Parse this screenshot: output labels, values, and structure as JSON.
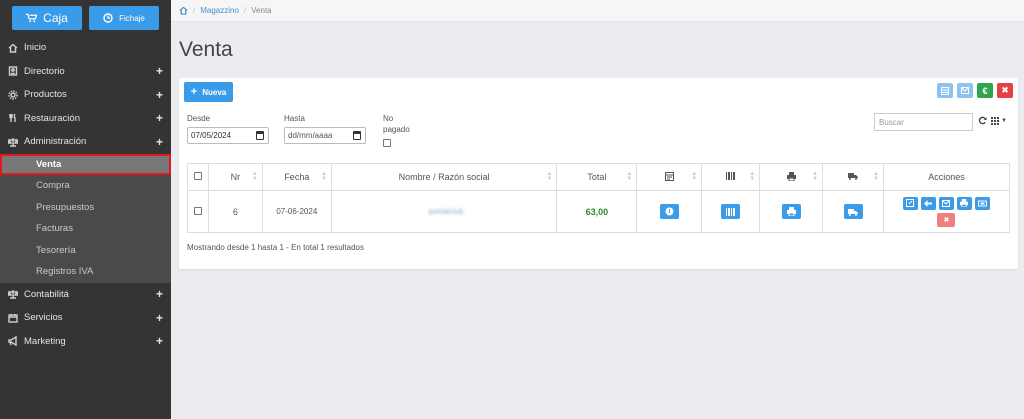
{
  "top_buttons": {
    "caja": "Caja",
    "fichaje": "Fichaje"
  },
  "sidebar": {
    "items": [
      {
        "label": "Inicio",
        "icon": "home-icon"
      },
      {
        "label": "Directorio",
        "icon": "contact-card-icon"
      },
      {
        "label": "Productos",
        "icon": "gear-icon"
      },
      {
        "label": "Restauración",
        "icon": "fork-knife-icon"
      },
      {
        "label": "Administración",
        "icon": "balance-scale-icon"
      }
    ],
    "sub_items": [
      "Venta",
      "Compra",
      "Presupuestos",
      "Facturas",
      "Tesorería",
      "Registros IVA"
    ],
    "items_after": [
      {
        "label": "Contabilitá",
        "icon": "balance-scale-icon"
      },
      {
        "label": "Servicios",
        "icon": "calendar-icon"
      },
      {
        "label": "Marketing",
        "icon": "megaphone-icon"
      }
    ]
  },
  "breadcrumb": {
    "level1": "Magazzino",
    "level2": "Venta"
  },
  "page": {
    "title": "Venta"
  },
  "toolbar": {
    "new_label": "Nueva"
  },
  "filters": {
    "from_label": "Desde",
    "from_value": "07/05/2024",
    "to_label": "Hasta",
    "to_value": "dd/mm/aaaa",
    "unpaid_label_1": "No",
    "unpaid_label_2": "pagado",
    "search_placeholder": "Buscar"
  },
  "table": {
    "headers": {
      "nr": "Nr",
      "fecha": "Fecha",
      "nombre": "Nombre / Razón social",
      "total": "Total",
      "acciones": "Acciones"
    },
    "rows": [
      {
        "nr": "6",
        "fecha": "07-06-2024",
        "nombre": "portalclub",
        "total": "63,00"
      }
    ]
  },
  "footer": {
    "info": "Mostrando desde 1 hasta 1 - En total 1 resultados"
  },
  "colors": {
    "primary": "#3a9be8",
    "sidebar_bg": "#343434",
    "active_outline": "#e0191f",
    "success": "#2fa64d",
    "danger": "#e54046"
  }
}
